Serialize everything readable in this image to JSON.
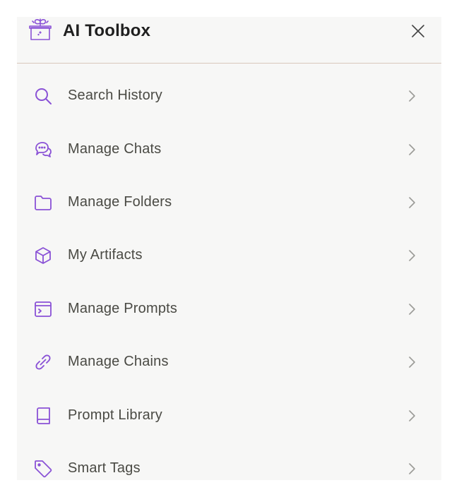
{
  "header": {
    "title": "AI Toolbox"
  },
  "colors": {
    "accent": "#8a52d6",
    "text": "#4a4a44",
    "title": "#1f1f1f",
    "chevron": "#9b9b97",
    "divider": "#d9c8bb",
    "panel": "#f7f7f6"
  },
  "menu": {
    "items": [
      {
        "label": "Search History",
        "icon": "search-icon"
      },
      {
        "label": "Manage Chats",
        "icon": "chat-bubbles-icon"
      },
      {
        "label": "Manage Folders",
        "icon": "folder-icon"
      },
      {
        "label": "My Artifacts",
        "icon": "cube-icon"
      },
      {
        "label": "Manage Prompts",
        "icon": "terminal-window-icon"
      },
      {
        "label": "Manage Chains",
        "icon": "link-icon"
      },
      {
        "label": "Prompt Library",
        "icon": "book-icon"
      },
      {
        "label": "Smart Tags",
        "icon": "tag-icon"
      }
    ]
  }
}
